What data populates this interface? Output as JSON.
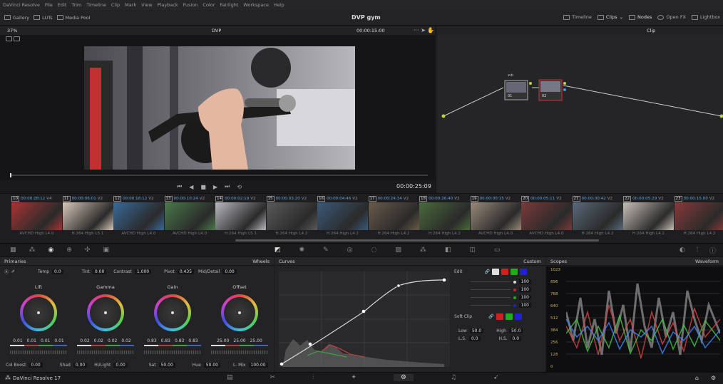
{
  "menu": [
    "DaVinci Resolve",
    "File",
    "Edit",
    "Trim",
    "Timeline",
    "Clip",
    "Mark",
    "View",
    "Playback",
    "Fusion",
    "Color",
    "Fairlight",
    "Workspace",
    "Help"
  ],
  "toolbar": {
    "gallery": "Gallery",
    "luts": "LUTs",
    "media_pool": "Media Pool",
    "project": "DVP gym",
    "timeline": "Timeline",
    "clips": "Clips",
    "nodes": "Nodes",
    "open_fx": "Open FX",
    "lightbox": "Lightbox"
  },
  "viewer": {
    "zoom": "37%",
    "name": "DVP",
    "timecode": "00:00:15:00",
    "current_tc": "00:00:25:09"
  },
  "node_panel": {
    "mode": "Clip",
    "node1_label": "wb",
    "node1_num": "01",
    "node2_num": "02"
  },
  "clips": [
    {
      "num": "10",
      "tc": "00:00:28:12",
      "track": "V4",
      "codec": "AVCHD High L4.0",
      "color": "#a33"
    },
    {
      "num": "11",
      "tc": "00:00:06:01",
      "track": "V2",
      "codec": "H.264 High L5.1",
      "color": "#d8c8b8"
    },
    {
      "num": "12",
      "tc": "00:00:16:12",
      "track": "V2",
      "codec": "AVCHD High L4.0",
      "color": "#3a6a9a"
    },
    {
      "num": "13",
      "tc": "00:00:10:24",
      "track": "V2",
      "codec": "AVCHD High L4.0",
      "color": "#4a7a4a"
    },
    {
      "num": "14",
      "tc": "00:00:02:19",
      "track": "V2",
      "codec": "H.264 High L5.1",
      "color": "#b8b8c0"
    },
    {
      "num": "15",
      "tc": "00:00:03:20",
      "track": "V2",
      "codec": "H.264 High L4.2",
      "color": "#5a5a5a"
    },
    {
      "num": "16",
      "tc": "00:00:04:46",
      "track": "V2",
      "codec": "H.264 High L4.2",
      "color": "#3a5a7a"
    },
    {
      "num": "17",
      "tc": "00:00:24:34",
      "track": "V2",
      "codec": "H.264 High L4.2",
      "color": "#6a5a4a"
    },
    {
      "num": "18",
      "tc": "00:00:26:40",
      "track": "V2",
      "codec": "H.264 High L4.2",
      "color": "#4a6a3a"
    },
    {
      "num": "19",
      "tc": "00:00:00:15",
      "track": "V2",
      "codec": "AVCHD High L4.0",
      "color": "#9a8a7a"
    },
    {
      "num": "20",
      "tc": "00:00:05:11",
      "track": "V2",
      "codec": "AVCHD High L4.0",
      "color": "#7a3a3a"
    },
    {
      "num": "21",
      "tc": "00:00:00:42",
      "track": "V2",
      "codec": "H.264 High L4.2",
      "color": "#5a6a7a"
    },
    {
      "num": "22",
      "tc": "00:00:05:29",
      "track": "V2",
      "codec": "H.264 High L4.2",
      "color": "#c8c0b8"
    },
    {
      "num": "23",
      "tc": "00:00:15:00",
      "track": "V2",
      "codec": "H.264 High L4.2",
      "color": "#8a3a3a"
    }
  ],
  "primaries": {
    "title": "Primaries",
    "mode": "Wheels",
    "temp_label": "Temp",
    "temp": "0.0",
    "tint_label": "Tint",
    "tint": "0.00",
    "contrast_label": "Contrast",
    "contrast": "1.000",
    "pivot_label": "Pivot",
    "pivot": "0.435",
    "middetail_label": "Mid/Detail",
    "middetail": "0.00",
    "wheels": [
      {
        "name": "Lift",
        "vals": [
          "0.01",
          "0.01",
          "0.01",
          "0.01"
        ]
      },
      {
        "name": "Gamma",
        "vals": [
          "0.02",
          "0.02",
          "0.02",
          "0.02"
        ]
      },
      {
        "name": "Gain",
        "vals": [
          "0.83",
          "0.83",
          "0.83",
          "0.83"
        ]
      },
      {
        "name": "Offset",
        "vals": [
          "25.00",
          "25.00",
          "25.00"
        ]
      }
    ],
    "colboost_label": "Col Boost",
    "colboost": "0.00",
    "shad_label": "Shad",
    "shad": "0.00",
    "hilight_label": "Hi/Light",
    "hilight": "0.00",
    "sat_label": "Sat",
    "sat": "50.00",
    "hue_label": "Hue",
    "hue": "50.00",
    "lmix_label": "L. Mix",
    "lmix": "100.00"
  },
  "curves": {
    "title": "Curves",
    "mode": "Custom",
    "edit_label": "Edit",
    "values": [
      "100",
      "100",
      "100",
      "100"
    ],
    "softclip_label": "Soft Clip",
    "low_label": "Low",
    "low": "50.0",
    "high_label": "High",
    "high": "50.0",
    "ls_label": "L.S.",
    "ls": "0.0",
    "hs_label": "H.S.",
    "hs": "0.0"
  },
  "scopes": {
    "title": "Scopes",
    "mode": "Waveform",
    "ticks": [
      "1023",
      "896",
      "768",
      "640",
      "512",
      "384",
      "256",
      "128",
      "0"
    ]
  },
  "status": {
    "app": "DaVinci Resolve 17"
  }
}
